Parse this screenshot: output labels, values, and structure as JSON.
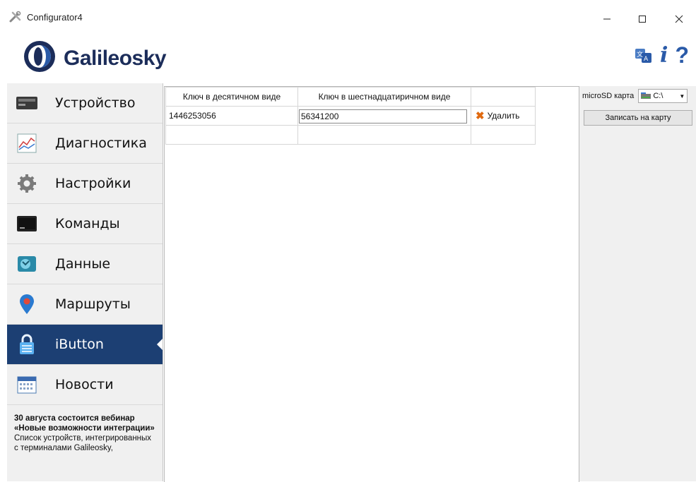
{
  "window": {
    "title": "Configurator4",
    "controls": {
      "minimize": "minimize-icon",
      "maximize": "maximize-icon",
      "close": "close-icon"
    }
  },
  "header": {
    "logo_text": "Galileosky",
    "icons": {
      "language": "language-icon",
      "info": "i",
      "help": "?"
    }
  },
  "colors": {
    "brand_dark": "#1c2d5a",
    "nav_active": "#1c3f73",
    "accent_blue": "#2a5aa8",
    "delete_orange": "#e06a10"
  },
  "sidebar": {
    "items": [
      {
        "label": "Устройство",
        "icon": "device-icon",
        "active": false
      },
      {
        "label": "Диагностика",
        "icon": "diagnostics-icon",
        "active": false
      },
      {
        "label": "Настройки",
        "icon": "gear-icon",
        "active": false
      },
      {
        "label": "Команды",
        "icon": "terminal-icon",
        "active": false
      },
      {
        "label": "Данные",
        "icon": "data-icon",
        "active": false
      },
      {
        "label": "Маршруты",
        "icon": "map-pin-icon",
        "active": false
      },
      {
        "label": "iButton",
        "icon": "lock-icon",
        "active": true
      },
      {
        "label": "Новости",
        "icon": "calendar-icon",
        "active": false
      }
    ],
    "news": {
      "title": "30 августа состоится вебинар «Новые возможности интеграции»",
      "body": "Список устройств, интегрированных с терминалами Galileosky,"
    }
  },
  "table": {
    "columns": [
      "Ключ в десятичном виде",
      "Ключ в шестнадцатиричном виде",
      ""
    ],
    "rows": [
      {
        "decimal": "1446253056",
        "hex": "56341200",
        "action": "Удалить"
      }
    ]
  },
  "right_panel": {
    "microsd_label": "microSD карта",
    "drive_value": "C:\\",
    "write_button": "Записать на карту"
  }
}
